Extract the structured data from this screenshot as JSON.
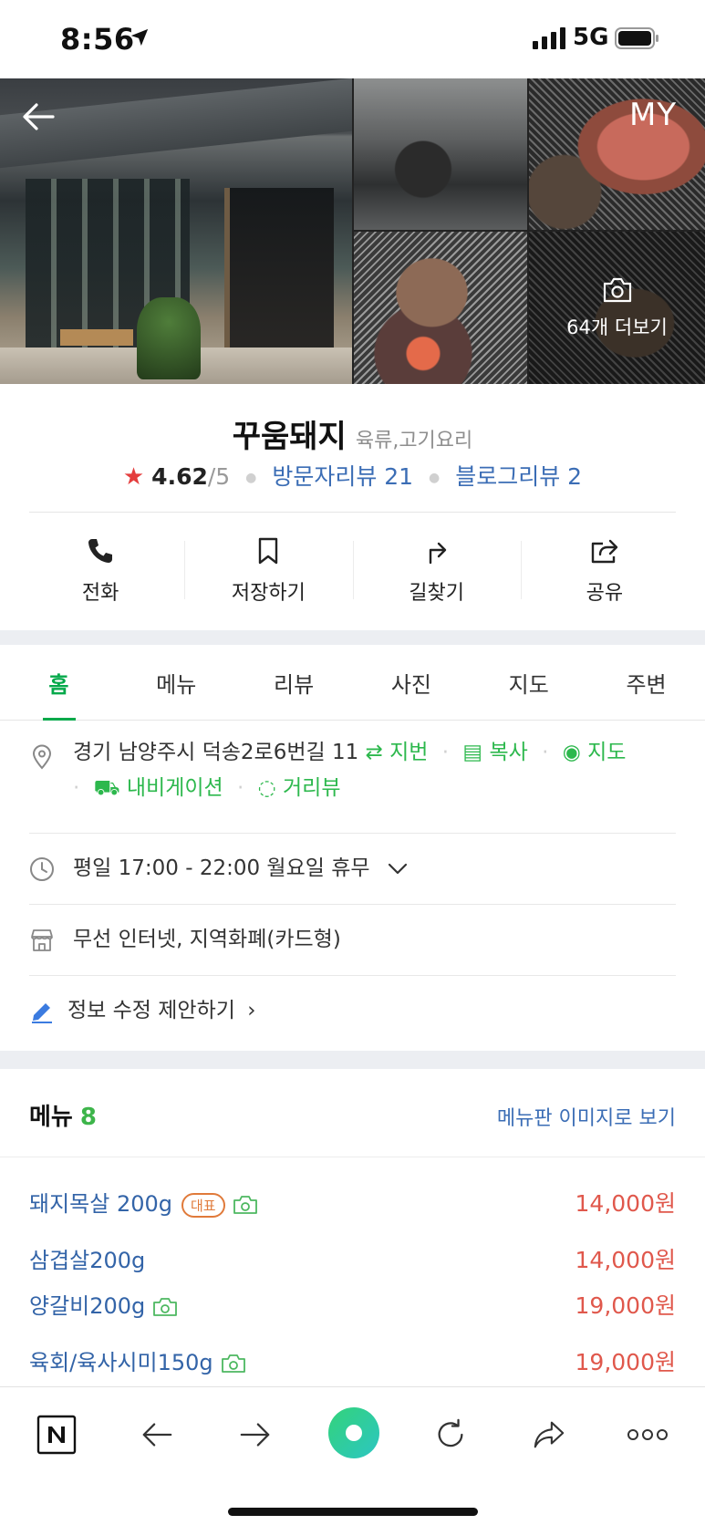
{
  "status_bar": {
    "time": "8:56",
    "network": "5G"
  },
  "gallery": {
    "my_label": "MY",
    "more_photos_label": "64개 더보기"
  },
  "place": {
    "name": "꾸움돼지",
    "category": "육류,고기요리",
    "rating": "4.62",
    "rating_max": "/5",
    "visitor_reviews": "방문자리뷰 21",
    "blog_reviews": "블로그리뷰 2"
  },
  "actions": [
    {
      "label": "전화",
      "icon": "phone-icon"
    },
    {
      "label": "저장하기",
      "icon": "bookmark-icon"
    },
    {
      "label": "길찾기",
      "icon": "directions-icon"
    },
    {
      "label": "공유",
      "icon": "share-icon"
    }
  ],
  "tabs": [
    "홈",
    "메뉴",
    "리뷰",
    "사진",
    "지도",
    "주변"
  ],
  "info": {
    "address": "경기 남양주시 덕송2로6번길 11",
    "address_links": {
      "lot": "지번",
      "copy": "복사",
      "map": "지도",
      "navigation": "내비게이션",
      "street_view": "거리뷰"
    },
    "hours": "평일 17:00 - 22:00 월요일 휴무",
    "amenities": "무선 인터넷, 지역화폐(카드형)",
    "suggest_edit": "정보 수정 제안하기"
  },
  "menu": {
    "title": "메뉴",
    "count": "8",
    "view_board": "메뉴판 이미지로 보기",
    "representative_badge": "대표",
    "items": [
      {
        "name": "돼지목살 200g",
        "price": "14,000원",
        "badge": true,
        "photo": true
      },
      {
        "name": "삼겹살200g",
        "price": "14,000원",
        "badge": false,
        "photo": false
      },
      {
        "name": "양갈비200g",
        "price": "19,000원",
        "badge": false,
        "photo": true
      },
      {
        "name": "육회/육사시미150g",
        "price": "19,000원",
        "badge": false,
        "photo": true
      }
    ]
  },
  "colors": {
    "accent_green": "#03a94a",
    "link_blue": "#3b6db5",
    "price_red": "#e0584c",
    "star_red": "#e43e3e"
  }
}
